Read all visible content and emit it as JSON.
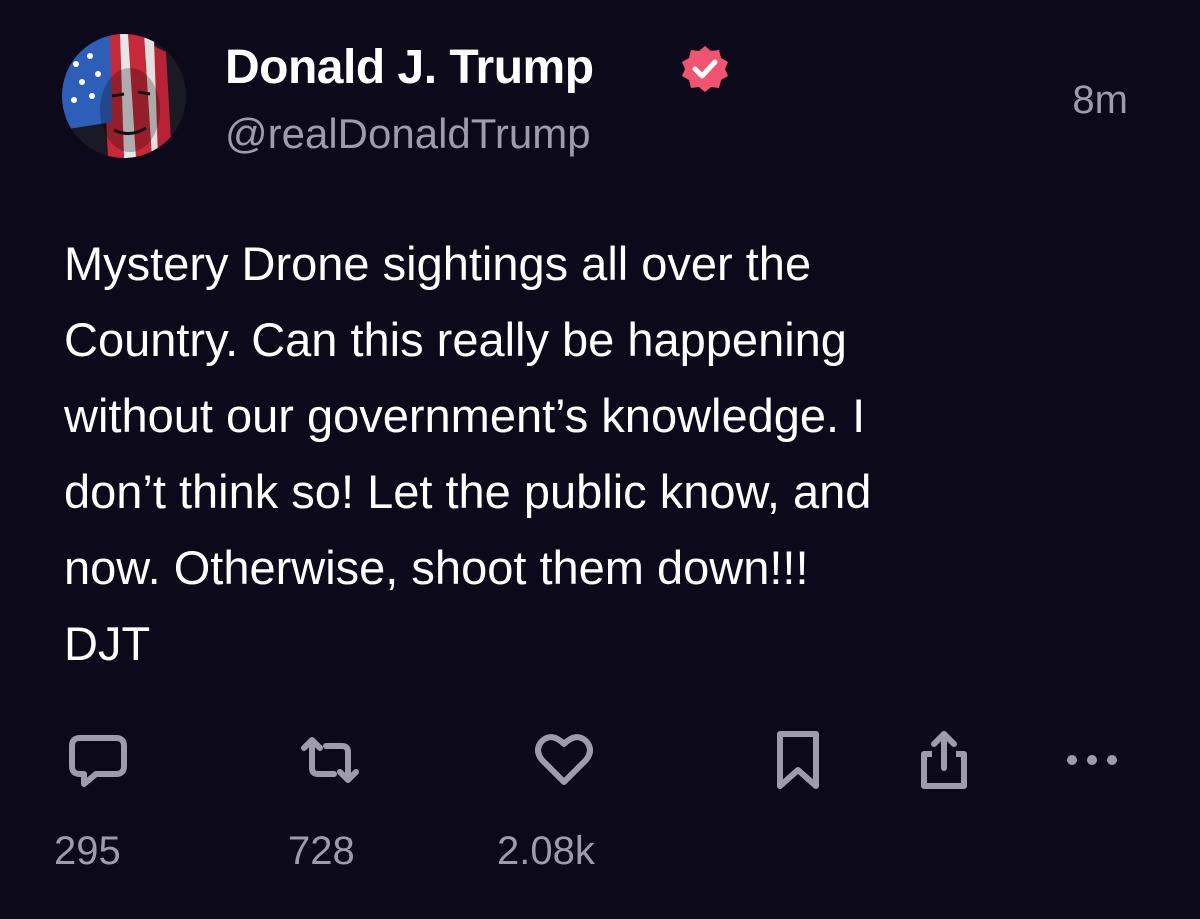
{
  "author": {
    "display_name": "Donald J. Trump",
    "handle": "@realDonaldTrump",
    "verified_icon": "verified-badge-icon",
    "verified_color": "#f0546f"
  },
  "timestamp": "8m",
  "post": {
    "lines": [
      "Mystery Drone sightings all over the",
      "Country. Can this really be happening",
      "without our government’s knowledge. I",
      "don’t think so! Let the public know, and",
      "now. Otherwise, shoot them down!!!",
      "DJT"
    ]
  },
  "actions": {
    "reply": {
      "icon": "reply-icon",
      "count": "295"
    },
    "repost": {
      "icon": "repost-icon",
      "count": "728"
    },
    "like": {
      "icon": "heart-icon",
      "count": "2.08k"
    },
    "bookmark": {
      "icon": "bookmark-icon"
    },
    "share": {
      "icon": "share-icon"
    },
    "more": {
      "icon": "more-icon"
    }
  },
  "colors": {
    "background": "#0c0a1a",
    "text": "#ffffff",
    "muted": "#9e9bab"
  }
}
